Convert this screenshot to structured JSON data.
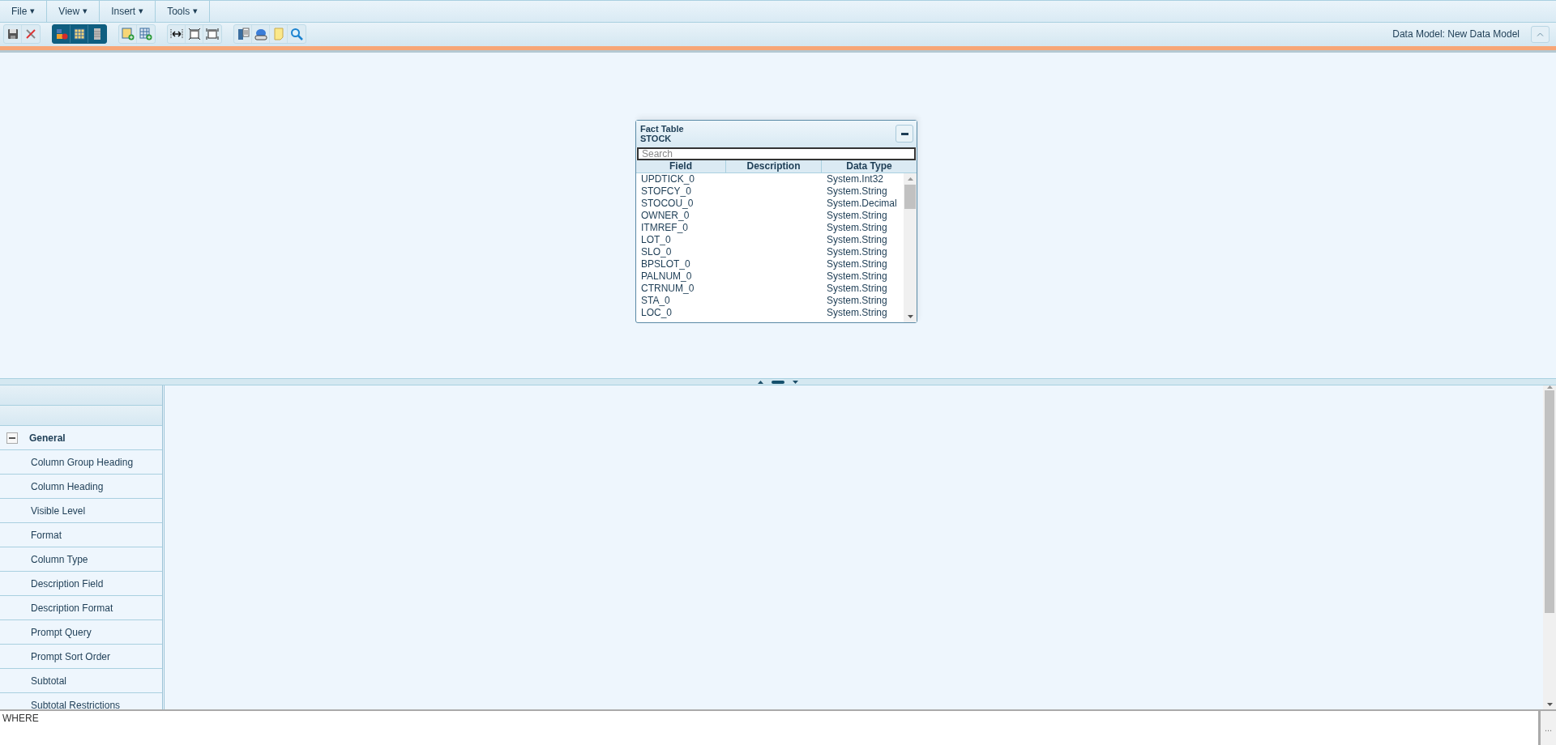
{
  "menu": [
    {
      "label": "File",
      "caret": "▾"
    },
    {
      "label": "View",
      "caret": "▾"
    },
    {
      "label": "Insert",
      "caret": "▾"
    },
    {
      "label": "Tools",
      "caret": "▾"
    }
  ],
  "data_model_label": "Data Model: New Data Model",
  "fact_table": {
    "kind_label": "Fact Table",
    "name": "STOCK",
    "search": {
      "placeholder": "Search"
    },
    "columns": [
      "Field",
      "Description",
      "Data Type"
    ],
    "rows": [
      {
        "field": "UPDTICK_0",
        "type": "System.Int32"
      },
      {
        "field": "STOFCY_0",
        "type": "System.String"
      },
      {
        "field": "STOCOU_0",
        "type": "System.Decimal"
      },
      {
        "field": "OWNER_0",
        "type": "System.String"
      },
      {
        "field": "ITMREF_0",
        "type": "System.String"
      },
      {
        "field": "LOT_0",
        "type": "System.String"
      },
      {
        "field": "SLO_0",
        "type": "System.String"
      },
      {
        "field": "BPSLOT_0",
        "type": "System.String"
      },
      {
        "field": "PALNUM_0",
        "type": "System.String"
      },
      {
        "field": "CTRNUM_0",
        "type": "System.String"
      },
      {
        "field": "STA_0",
        "type": "System.String"
      },
      {
        "field": "LOC_0",
        "type": "System.String"
      }
    ]
  },
  "properties": {
    "group": {
      "label": "General",
      "expanded": true,
      "items": [
        "Column Group Heading",
        "Column Heading",
        "Visible Level",
        "Format",
        "Column Type",
        "Description Field",
        "Description Format",
        "Prompt Query",
        "Prompt Sort Order",
        "Subtotal",
        "Subtotal Restrictions"
      ]
    }
  },
  "where": {
    "value": "WHERE",
    "button": "..."
  }
}
